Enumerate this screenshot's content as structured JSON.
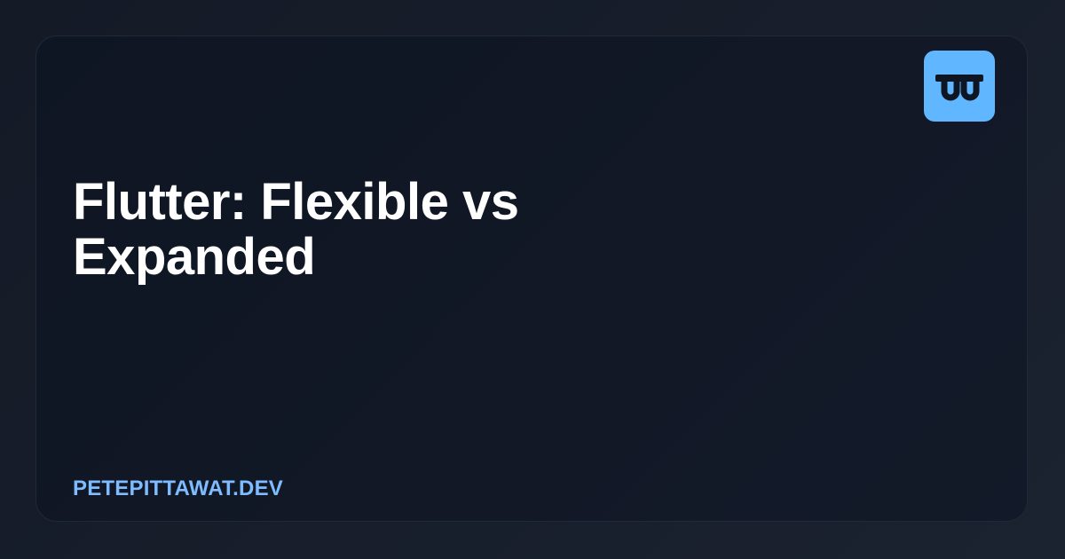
{
  "post": {
    "title": "Flutter: Flexible vs Expanded",
    "site": "PETEPITTAWAT.DEV"
  },
  "logo": {
    "icon": "pete-logo-icon",
    "badge_color": "#60b6ff",
    "glyph_color": "#0f1623"
  },
  "colors": {
    "background": "#161c28",
    "card": "#111827",
    "title": "#ffffff",
    "site": "#7fbcff"
  }
}
